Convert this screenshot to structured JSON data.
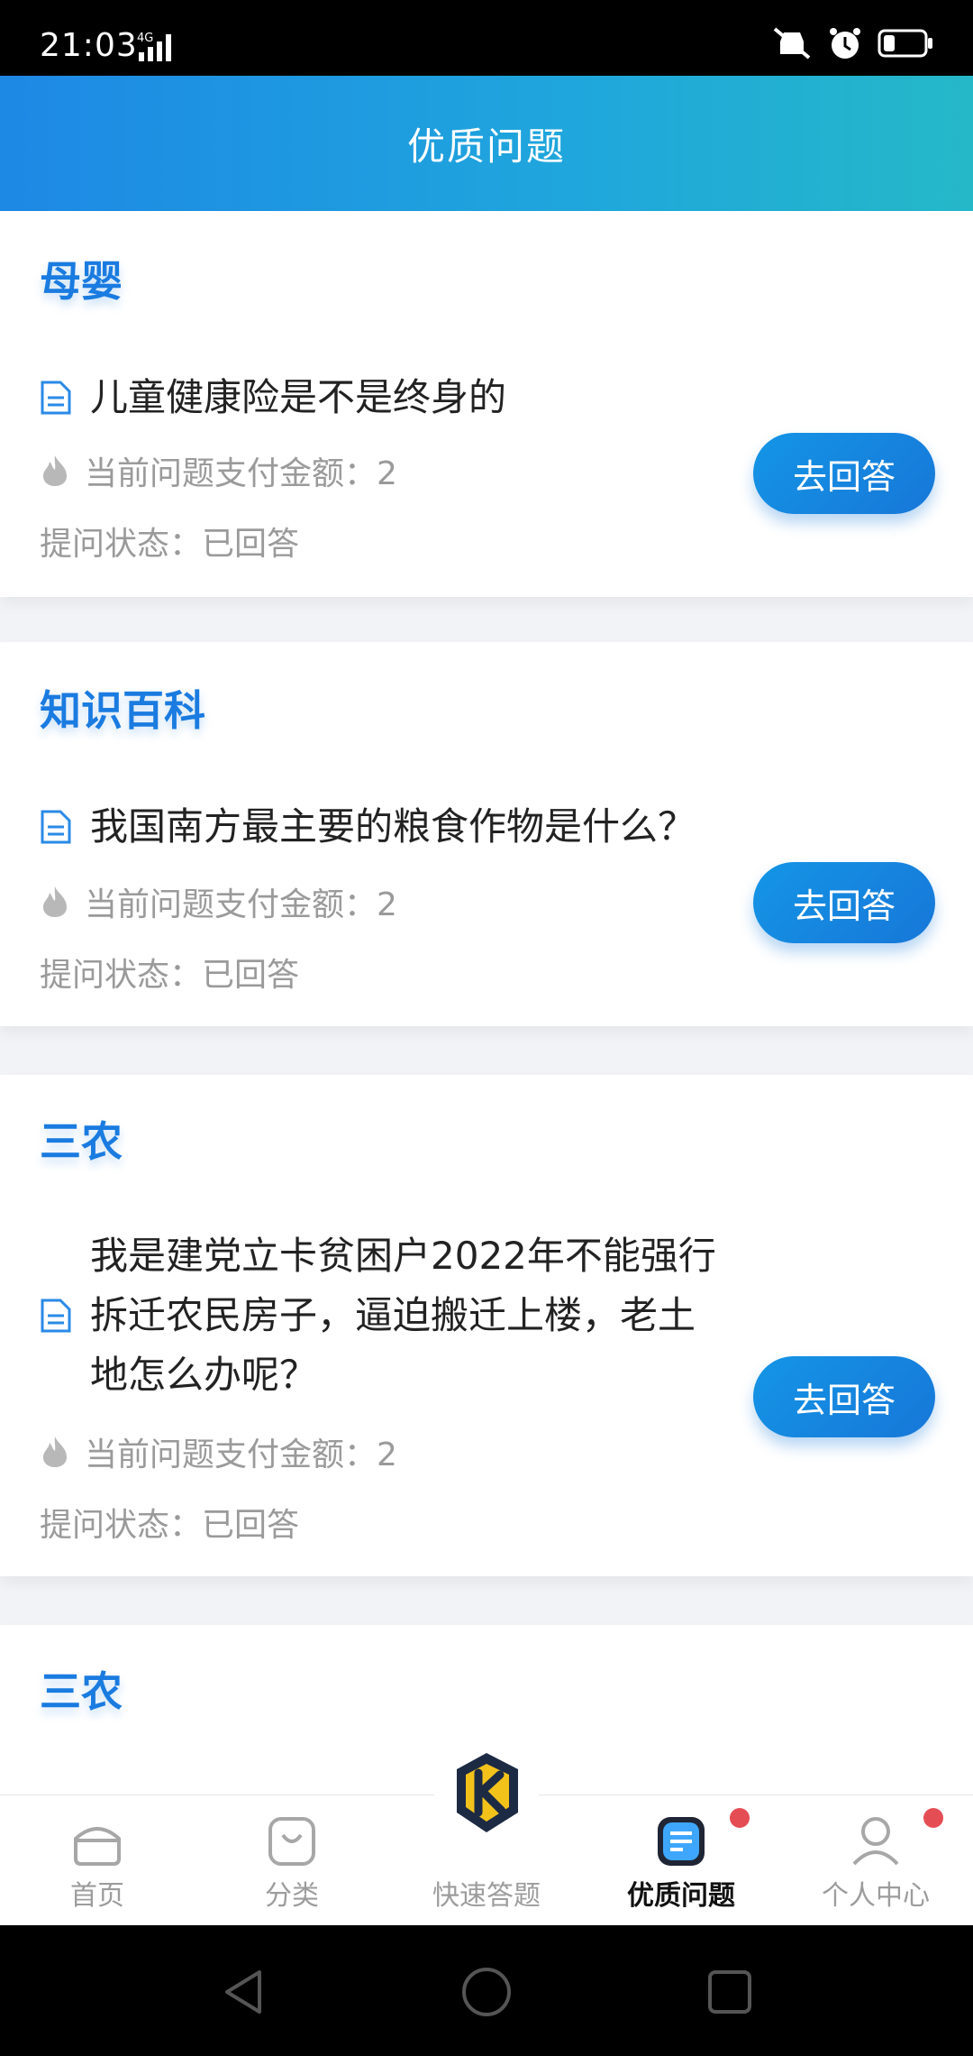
{
  "status_bar": {
    "time": "21:03",
    "network": "4G"
  },
  "header": {
    "title": "优质问题"
  },
  "cards": [
    {
      "category": "母婴",
      "question_lines": [
        "儿童健康险是不是终身的"
      ],
      "amount": "当前问题支付金额：2",
      "status": "提问状态：已回答",
      "button": "去回答"
    },
    {
      "category": "知识百科",
      "question_lines": [
        "我国南方最主要的粮食作物是什么？"
      ],
      "amount": "当前问题支付金额：2",
      "status": "提问状态：已回答",
      "button": "去回答"
    },
    {
      "category": "三农",
      "question_lines": [
        "我是建党立卡贫困户2022年不能强行",
        "拆迁农民房子，逼迫搬迁上楼，老土",
        "地怎么办呢？"
      ],
      "amount": "当前问题支付金额：2",
      "status": "提问状态：已回答",
      "button": "去回答"
    },
    {
      "category": "三农",
      "question_lines": []
    }
  ],
  "tabs": [
    {
      "label": "首页",
      "icon": "home-icon",
      "active": false
    },
    {
      "label": "分类",
      "icon": "category-bag-icon",
      "active": false
    },
    {
      "label": "快速答题",
      "icon": "k-logo-icon",
      "active": false
    },
    {
      "label": "优质问题",
      "icon": "quality-question-icon",
      "active": true
    },
    {
      "label": "个人中心",
      "icon": "user-icon",
      "active": false
    }
  ],
  "colors": {
    "accent": "#1a7be0",
    "header_start": "#1e88e5",
    "header_end": "#25b8c8",
    "badge": "#e54d55",
    "button": "#1588e0"
  }
}
